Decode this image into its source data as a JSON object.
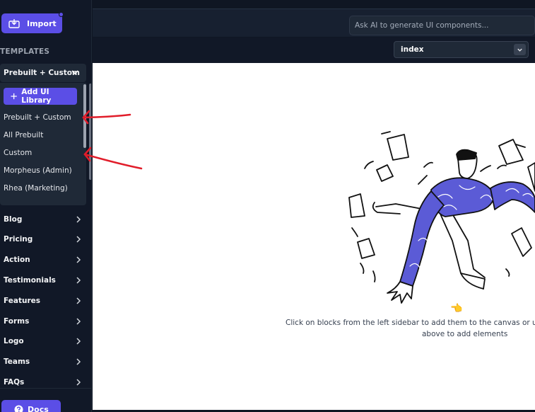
{
  "sidebar": {
    "import_label": "Import",
    "templates_label": "TEMPLATES",
    "library_select": "Prebuilt + Custom",
    "add_library_label": "Add UI Library",
    "dropdown_items": [
      "Prebuilt + Custom",
      "All Prebuilt",
      "Custom",
      "Morpheus (Admin)",
      "Rhea (Marketing)"
    ],
    "categories": [
      "Blog",
      "Pricing",
      "Action",
      "Testimonials",
      "Features",
      "Forms",
      "Logo",
      "Teams",
      "FAQs"
    ],
    "docs_label": "Docs"
  },
  "topbar": {
    "ai_placeholder": "Ask AI to generate UI components..."
  },
  "page_select": {
    "value": "index"
  },
  "canvas": {
    "hint_line1": "Click on blocks from the left sidebar to add them to the canvas or use the AI",
    "hint_line2": "above to add elements",
    "hint_icon": "pointing-hand-icon"
  },
  "colors": {
    "accent": "#5b4ee6",
    "sidebar_bg": "#111827",
    "annotation": "#e11d2a"
  }
}
